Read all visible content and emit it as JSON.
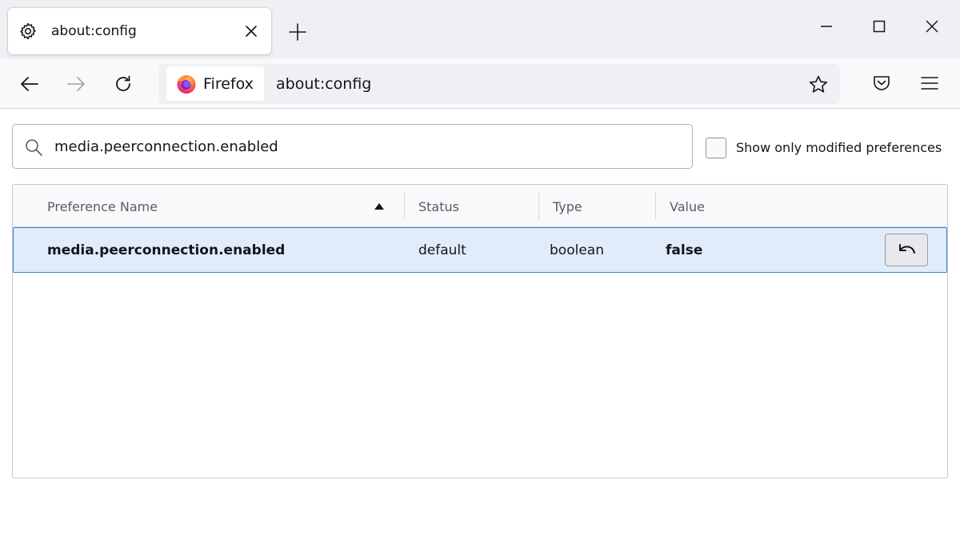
{
  "tab": {
    "title": "about:config",
    "icon": "gear-icon"
  },
  "navbar": {
    "identity_label": "Firefox",
    "url": "about:config"
  },
  "search": {
    "value": "media.peerconnection.enabled",
    "modified_only_label": "Show only modified preferences",
    "modified_only_checked": false
  },
  "table": {
    "columns": [
      "Preference Name",
      "Status",
      "Type",
      "Value"
    ],
    "sort": {
      "column": "Preference Name",
      "direction": "ascending"
    },
    "rows": [
      {
        "name": "media.peerconnection.enabled",
        "status": "default",
        "type": "boolean",
        "value": "false"
      }
    ]
  },
  "colors": {
    "accent": "#3b82d6",
    "selected_row": "#e0ecfa",
    "tabstrip_bg": "#f0f0f4",
    "firefox_orange": "#ff7139"
  }
}
